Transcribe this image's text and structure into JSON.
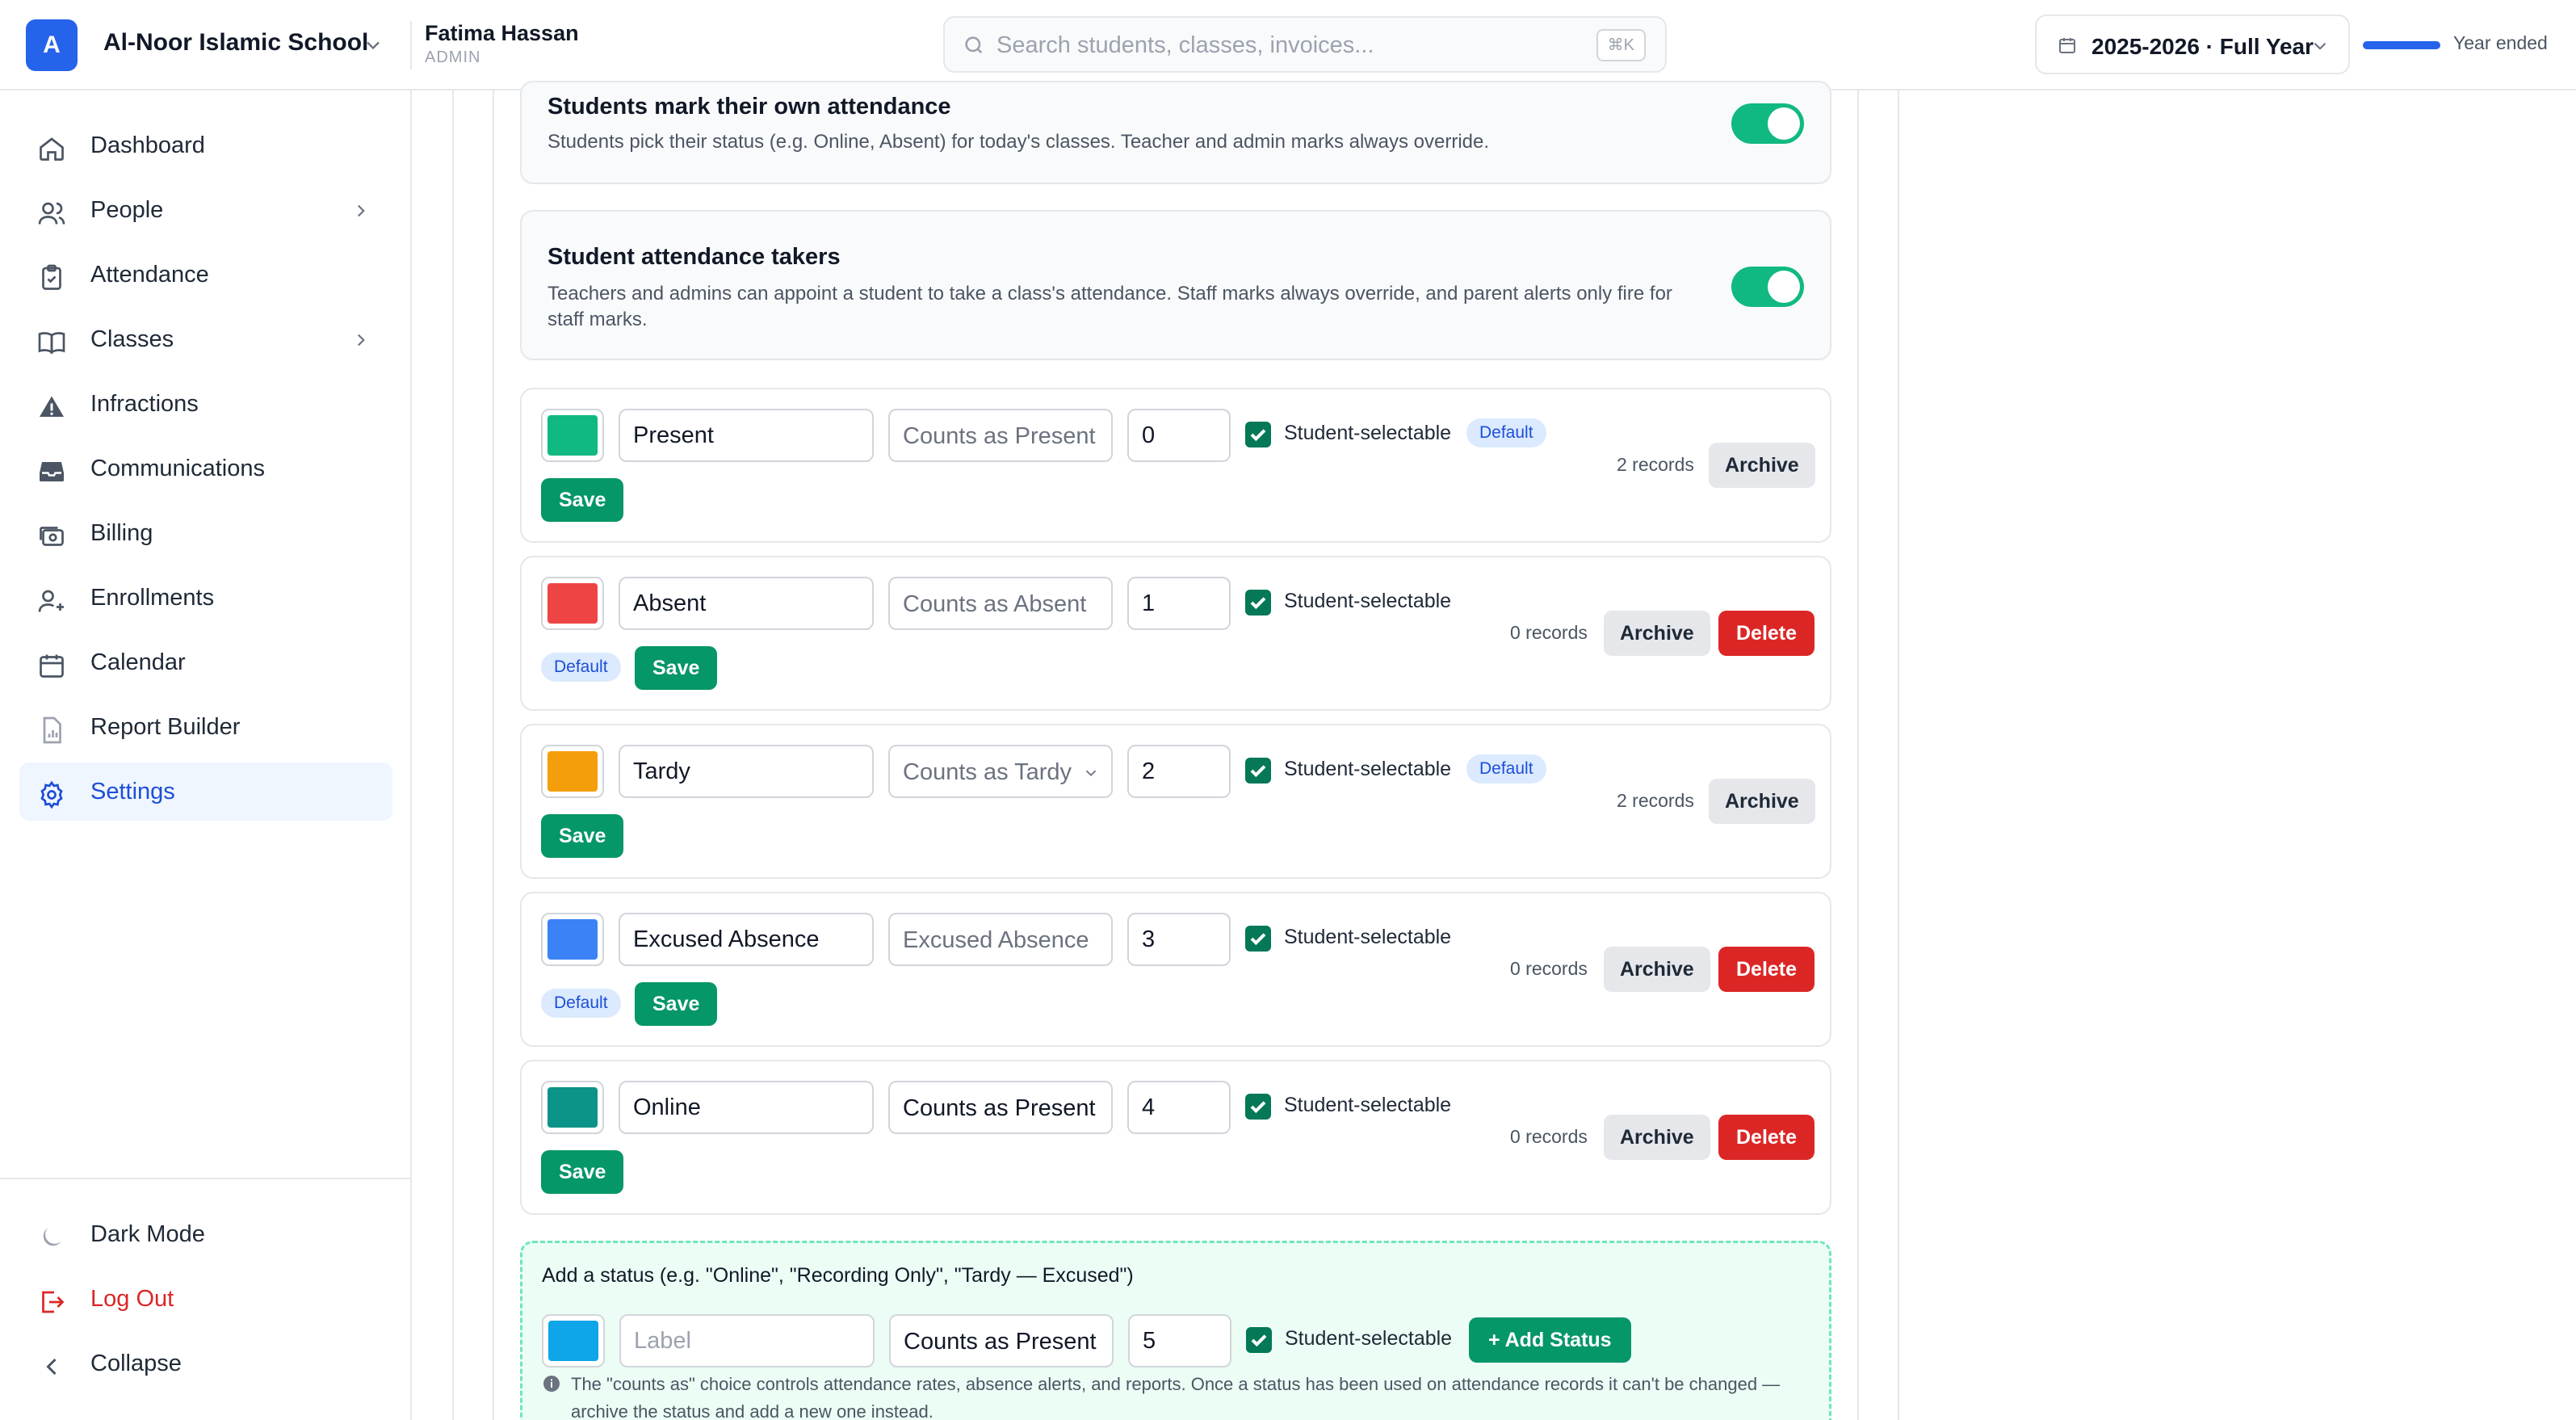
{
  "header": {
    "logo_letter": "A",
    "school_name": "Al-Noor Islamic School",
    "user_name": "Fatima Hassan",
    "user_role": "ADMIN",
    "search_placeholder": "Search students, classes, invoices...",
    "search_shortcut": "⌘K",
    "year_label": "2025-2026 · Full Year",
    "year_status": "Year ended",
    "year_progress_percent": 100
  },
  "sidebar": {
    "items": [
      {
        "label": "Dashboard",
        "icon": "home-icon"
      },
      {
        "label": "People",
        "icon": "users-icon"
      },
      {
        "label": "Attendance",
        "icon": "clipboard-check-icon"
      },
      {
        "label": "Classes",
        "icon": "book-icon"
      },
      {
        "label": "Infractions",
        "icon": "warning-icon"
      },
      {
        "label": "Communications",
        "icon": "inbox-icon"
      },
      {
        "label": "Billing",
        "icon": "billing-icon"
      },
      {
        "label": "Enrollments",
        "icon": "user-plus-icon"
      },
      {
        "label": "Calendar",
        "icon": "calendar-icon"
      },
      {
        "label": "Report Builder",
        "icon": "report-icon"
      },
      {
        "label": "Settings",
        "icon": "gear-icon"
      }
    ],
    "bottom": {
      "dark_mode": "Dark Mode",
      "logout": "Log Out",
      "collapse": "Collapse"
    }
  },
  "settings": {
    "self_attendance": {
      "title": "Students mark their own attendance",
      "desc": "Students pick their status (e.g. Online, Absent) for today's classes. Teacher and admin marks always override.",
      "enabled": true
    },
    "attendance_takers": {
      "title": "Student attendance takers",
      "desc": "Teachers and admins can appoint a student to take a class's attendance. Staff marks always override, and parent alerts only fire for staff marks.",
      "enabled": true
    }
  },
  "labels": {
    "student_selectable": "Student-selectable",
    "default_badge": "Default",
    "save": "Save",
    "archive": "Archive",
    "delete": "Delete"
  },
  "statuses": [
    {
      "label": "Present",
      "color": "#10b981",
      "counts_as": "Counts as Present",
      "order": "0",
      "records": "2 records"
    },
    {
      "label": "Absent",
      "color": "#ef4444",
      "counts_as": "Counts as Absent",
      "order": "1",
      "records": "0 records"
    },
    {
      "label": "Tardy",
      "color": "#f59e0b",
      "counts_as": "Counts as Tardy",
      "order": "2",
      "records": "2 records"
    },
    {
      "label": "Excused Absence",
      "color": "#3b82f6",
      "counts_as": "Excused Absence",
      "order": "3",
      "records": "0 records"
    },
    {
      "label": "Online",
      "color": "#0d9488",
      "counts_as": "Counts as Present",
      "order": "4",
      "records": "0 records"
    }
  ],
  "add_status": {
    "title": "Add a status (e.g. \"Online\", \"Recording Only\", \"Tardy — Excused\")",
    "label_placeholder": "Label",
    "color": "#0ea5e9",
    "counts_as": "Counts as Present",
    "order": "5",
    "button": "+ Add Status",
    "info": "The \"counts as\" choice controls attendance rates, absence alerts, and reports. Once a status has been used on attendance records it can't be changed — archive the status and add a new one instead."
  }
}
